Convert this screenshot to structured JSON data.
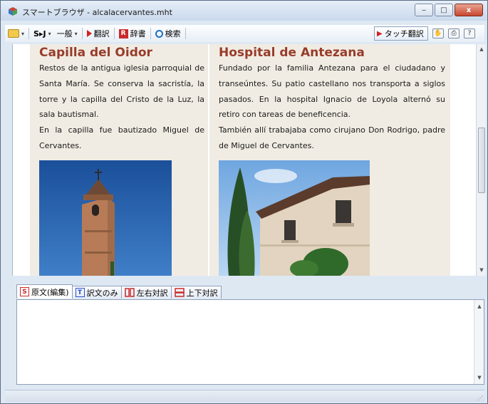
{
  "window": {
    "title": "スマートブラウザ - alcalacervantes.mht",
    "controls": {
      "minimize": "‒",
      "maximize": "□",
      "close": "x"
    }
  },
  "toolbar": {
    "source_lang": "S▸J",
    "field_label": "一般",
    "translate_label": "翻訳",
    "dictionary_label": "辞書",
    "search_label": "検索",
    "touch_translate_label": "タッチ翻訳"
  },
  "article": {
    "left": {
      "heading": "Capilla del Oidor",
      "paragraphs": [
        "Restos de la antigua iglesia parroquial de Santa María. Se conserva la sacristía, la torre y la capilla del Cristo de la Luz, la sala bautismal.",
        "En la capilla fue bautizado Miguel de Cervantes."
      ]
    },
    "right": {
      "heading": "Hospital de Antezana",
      "paragraphs": [
        "Fundado por la familia Antezana para el ciudadano y transeúntes. Su patio castellano nos transporta a siglos pasados. En la hospital Ignacio de Loyola alternó su retiro con tareas de beneficencia.",
        "También allí trabajaba como cirujano Don Rodrigo, padre de Miguel de Cervantes."
      ]
    }
  },
  "lower_tabs": [
    {
      "icon": "S",
      "label": "原文(編集)"
    },
    {
      "icon": "T",
      "label": "訳文のみ"
    },
    {
      "icon": "",
      "label": "左右対訳"
    },
    {
      "icon": "",
      "label": "上下対訳"
    }
  ],
  "colors": {
    "heading": "#983c2b",
    "column_bg": "#f1ece3",
    "accent_red": "#c92a2a"
  }
}
